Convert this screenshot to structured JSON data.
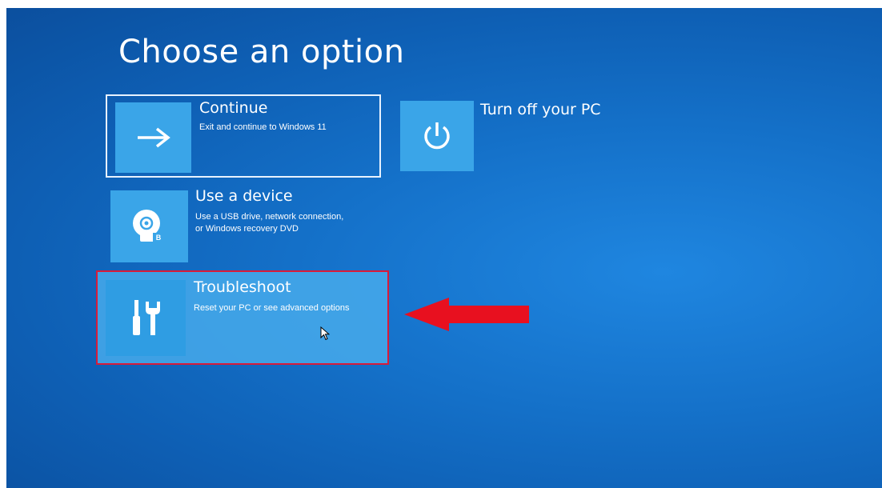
{
  "screen": {
    "title": "Choose an option"
  },
  "options": {
    "continue": {
      "title": "Continue",
      "description": "Exit and continue to Windows 11",
      "icon": "arrow-right-icon"
    },
    "turn_off": {
      "title": "Turn off your PC",
      "icon": "power-icon"
    },
    "use_device": {
      "title": "Use a device",
      "description": "Use a USB drive, network connection,\nor Windows recovery DVD",
      "icon": "disc-drive-icon"
    },
    "troubleshoot": {
      "title": "Troubleshoot",
      "description": "Reset your PC or see advanced options",
      "icon": "tools-icon"
    }
  },
  "annotation": {
    "arrow_color": "#e8101f",
    "highlight_color": "#d81b3a"
  },
  "colors": {
    "background": "#1470c8",
    "tile": "#3aa5e8",
    "text": "#ffffff"
  }
}
